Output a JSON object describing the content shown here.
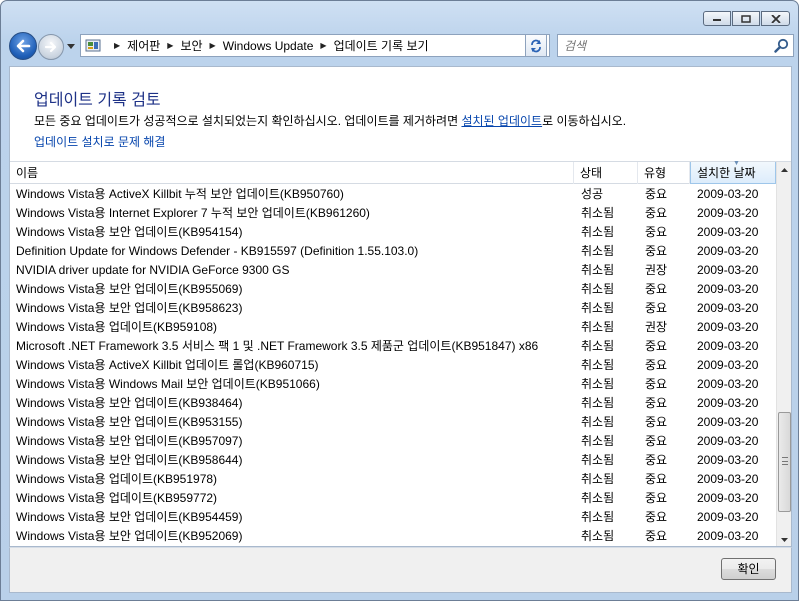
{
  "navigation": {
    "breadcrumbs": [
      "제어판",
      "보안",
      "Windows Update",
      "업데이트 기록 보기"
    ],
    "search_placeholder": "검색"
  },
  "page": {
    "title": "업데이트 기록 검토",
    "description_before": "모든 중요 업데이트가 성공적으로 설치되었는지 확인하십시오. 업데이트를 제거하려면 ",
    "description_link": "설치된 업데이트",
    "description_after": "로 이동하십시오.",
    "troubleshoot_link": "업데이트 설치로 문제 해결"
  },
  "list": {
    "columns": [
      "이름",
      "상태",
      "유형",
      "설치한 날짜"
    ],
    "sorted_column": "설치한 날짜",
    "rows": [
      {
        "name": "Windows Vista용 ActiveX Killbit 누적 보안 업데이트(KB950760)",
        "status": "성공",
        "type": "중요",
        "date": "2009-03-20"
      },
      {
        "name": "Windows Vista용 Internet Explorer 7 누적 보안 업데이트(KB961260)",
        "status": "취소됨",
        "type": "중요",
        "date": "2009-03-20"
      },
      {
        "name": "Windows Vista용 보안 업데이트(KB954154)",
        "status": "취소됨",
        "type": "중요",
        "date": "2009-03-20"
      },
      {
        "name": "Definition Update for Windows Defender - KB915597 (Definition 1.55.103.0)",
        "status": "취소됨",
        "type": "중요",
        "date": "2009-03-20"
      },
      {
        "name": "NVIDIA driver update for NVIDIA GeForce 9300 GS",
        "status": "취소됨",
        "type": "권장",
        "date": "2009-03-20"
      },
      {
        "name": "Windows Vista용 보안 업데이트(KB955069)",
        "status": "취소됨",
        "type": "중요",
        "date": "2009-03-20"
      },
      {
        "name": "Windows Vista용 보안 업데이트(KB958623)",
        "status": "취소됨",
        "type": "중요",
        "date": "2009-03-20"
      },
      {
        "name": "Windows Vista용 업데이트(KB959108)",
        "status": "취소됨",
        "type": "권장",
        "date": "2009-03-20"
      },
      {
        "name": "Microsoft .NET Framework 3.5 서비스 팩 1 및 .NET Framework 3.5 제품군 업데이트(KB951847) x86",
        "status": "취소됨",
        "type": "중요",
        "date": "2009-03-20"
      },
      {
        "name": "Windows Vista용 ActiveX Killbit 업데이트 롤업(KB960715)",
        "status": "취소됨",
        "type": "중요",
        "date": "2009-03-20"
      },
      {
        "name": "Windows Vista용 Windows Mail 보안 업데이트(KB951066)",
        "status": "취소됨",
        "type": "중요",
        "date": "2009-03-20"
      },
      {
        "name": "Windows Vista용 보안 업데이트(KB938464)",
        "status": "취소됨",
        "type": "중요",
        "date": "2009-03-20"
      },
      {
        "name": "Windows Vista용 보안 업데이트(KB953155)",
        "status": "취소됨",
        "type": "중요",
        "date": "2009-03-20"
      },
      {
        "name": "Windows Vista용 보안 업데이트(KB957097)",
        "status": "취소됨",
        "type": "중요",
        "date": "2009-03-20"
      },
      {
        "name": "Windows Vista용 보안 업데이트(KB958644)",
        "status": "취소됨",
        "type": "중요",
        "date": "2009-03-20"
      },
      {
        "name": "Windows Vista용 업데이트(KB951978)",
        "status": "취소됨",
        "type": "중요",
        "date": "2009-03-20"
      },
      {
        "name": "Windows Vista용 업데이트(KB959772)",
        "status": "취소됨",
        "type": "중요",
        "date": "2009-03-20"
      },
      {
        "name": "Windows Vista용 보안 업데이트(KB954459)",
        "status": "취소됨",
        "type": "중요",
        "date": "2009-03-20"
      },
      {
        "name": "Windows Vista용 보안 업데이트(KB952069)",
        "status": "취소됨",
        "type": "중요",
        "date": "2009-03-20"
      }
    ]
  },
  "footer": {
    "ok_label": "확인"
  },
  "icons": {
    "back": "back-arrow-icon",
    "forward": "forward-arrow-icon",
    "control_panel": "control-panel-icon",
    "refresh": "refresh-icon",
    "search": "search-icon",
    "minimize": "minimize-icon",
    "maximize": "maximize-icon",
    "close": "close-icon"
  },
  "colors": {
    "title_blue": "#1e3287",
    "link_blue": "#0645ad",
    "frame_blue": "#bcd3ec"
  }
}
